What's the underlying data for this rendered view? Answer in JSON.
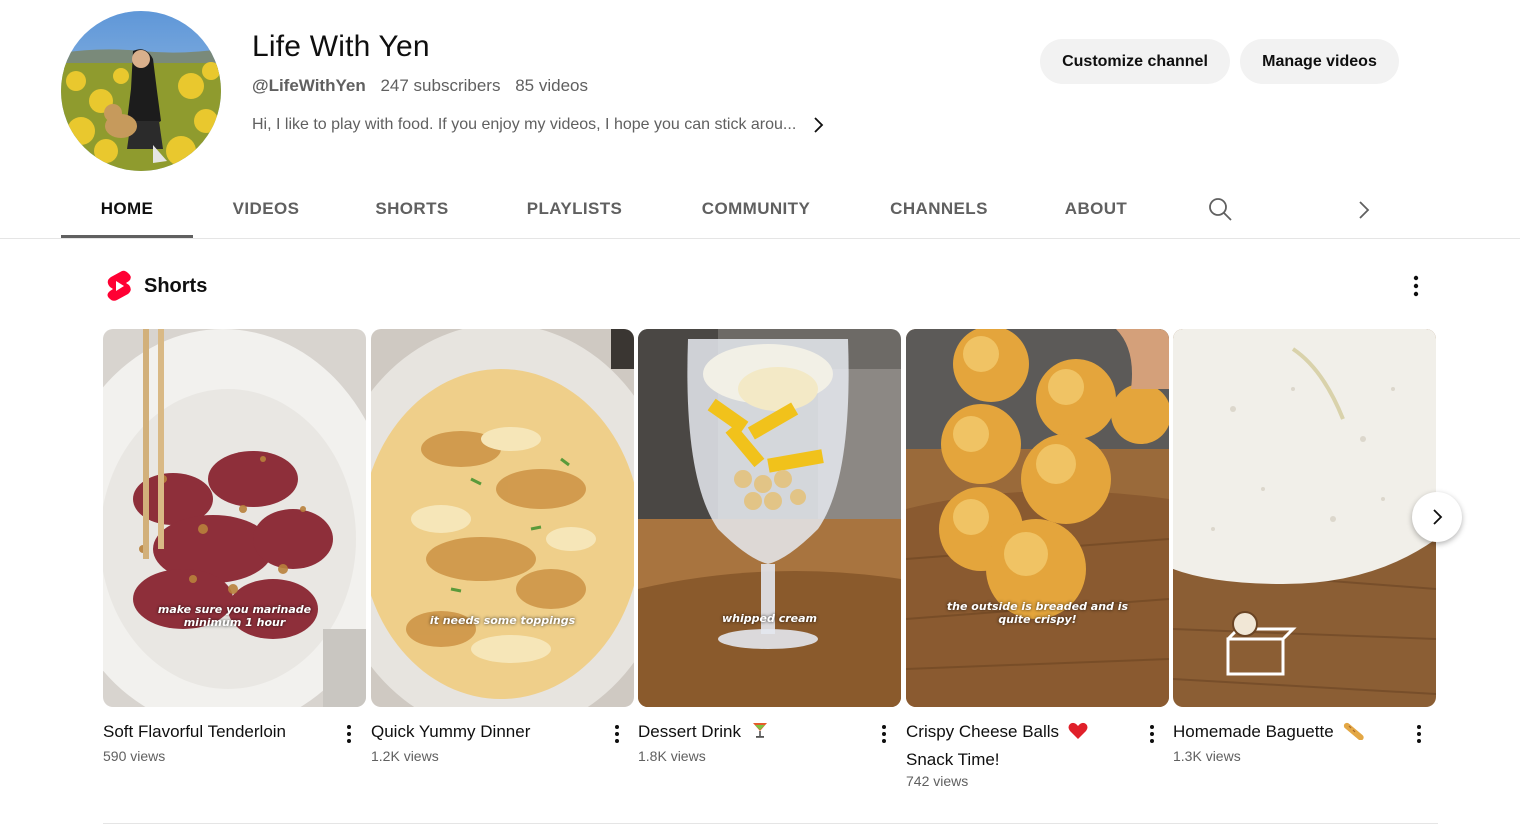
{
  "channel": {
    "name": "Life With Yen",
    "handle": "@LifeWithYen",
    "subscribers": "247 subscribers",
    "videos_count": "85 videos",
    "description": "Hi, I like to play with food. If you enjoy my videos, I hope you can stick arou..."
  },
  "actions": {
    "customize_label": "Customize channel",
    "manage_label": "Manage videos"
  },
  "tabs": [
    {
      "label": "HOME",
      "active": true
    },
    {
      "label": "VIDEOS"
    },
    {
      "label": "SHORTS"
    },
    {
      "label": "PLAYLISTS"
    },
    {
      "label": "COMMUNITY"
    },
    {
      "label": "CHANNELS"
    },
    {
      "label": "ABOUT"
    }
  ],
  "shorts": {
    "title": "Shorts",
    "items": [
      {
        "title": "Soft Flavorful Tenderloin",
        "emoji": "",
        "views": "590 views",
        "overlay_line1": "make sure you marinade",
        "overlay_line2": "minimum 1 hour"
      },
      {
        "title": "Quick Yummy Dinner",
        "emoji": "",
        "views": "1.2K views",
        "overlay_line1": "it needs some toppings",
        "overlay_line2": ""
      },
      {
        "title": "Dessert Drink",
        "emoji": "cocktail-emoji",
        "views": "1.8K views",
        "overlay_line1": "whipped cream",
        "overlay_line2": ""
      },
      {
        "title": "Crispy Cheese Balls",
        "title_line2": "Snack Time!",
        "emoji": "heart-emoji",
        "views": "742 views",
        "overlay_line1": "the outside is breaded and is",
        "overlay_line2": "quite crispy!"
      },
      {
        "title": "Homemade Baguette",
        "emoji": "baguette-emoji",
        "views": "1.3K views",
        "overlay_line1": "",
        "overlay_line2": ""
      }
    ]
  },
  "colors": {
    "shorts_red": "#ff0033",
    "chip_bg": "#f2f2f2",
    "secondary_text": "#606060"
  }
}
